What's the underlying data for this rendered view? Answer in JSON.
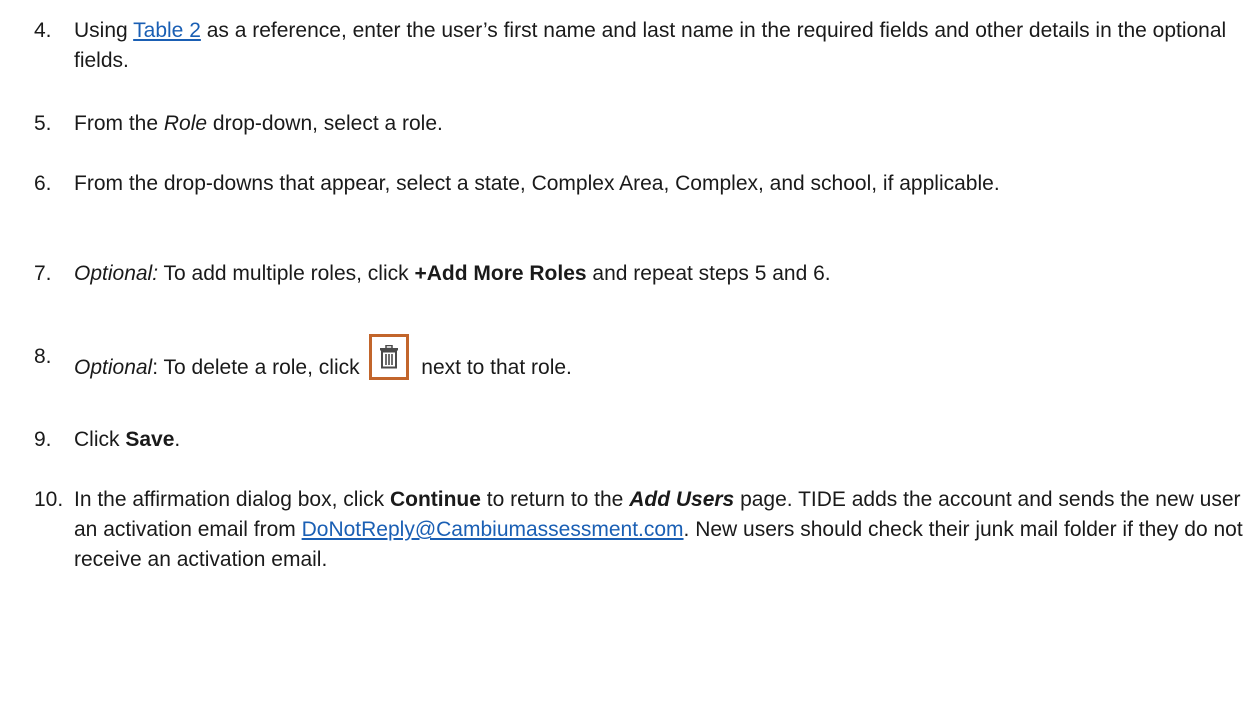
{
  "steps": [
    {
      "num": "4.",
      "pre": "Using ",
      "link": "Table 2",
      "post": " as a reference, enter the user’s first name and last name in the required fields and other details in the optional fields."
    },
    {
      "num": "5.",
      "pre": "From the ",
      "role_em": "Role",
      "post": " drop-down, select a role."
    },
    {
      "num": "6.",
      "text": "From the drop-downs that appear, select a state, Complex Area, Complex, and school, if applicable."
    },
    {
      "num": "7.",
      "optional": "Optional:",
      "pre": " To add multiple roles, click ",
      "bold": "+Add More Roles",
      "post": " and repeat steps 5 and 6."
    },
    {
      "num": "8.",
      "optional": "Optional",
      "pre": ": To delete a role, click ",
      "post": " next to that role.",
      "icon": "trash-icon",
      "icon_color": "#c2652b"
    },
    {
      "num": "9.",
      "pre": "Click ",
      "bold": "Save",
      "post": "."
    },
    {
      "num": "10.",
      "pre": "In the affirmation dialog box, click ",
      "bold": "Continue",
      "mid": " to return to the ",
      "bold_em": "Add Users",
      "post": " page. TIDE adds the account and sends the new user an activation email from ",
      "link": "DoNotReply@Cambiumassessment.com",
      "tail": ". New users should check their junk mail folder if they do not receive an activation email."
    }
  ],
  "colors": {
    "link": "#1a5fb4",
    "icon_border": "#c2652b",
    "text": "#1a1a1a"
  }
}
